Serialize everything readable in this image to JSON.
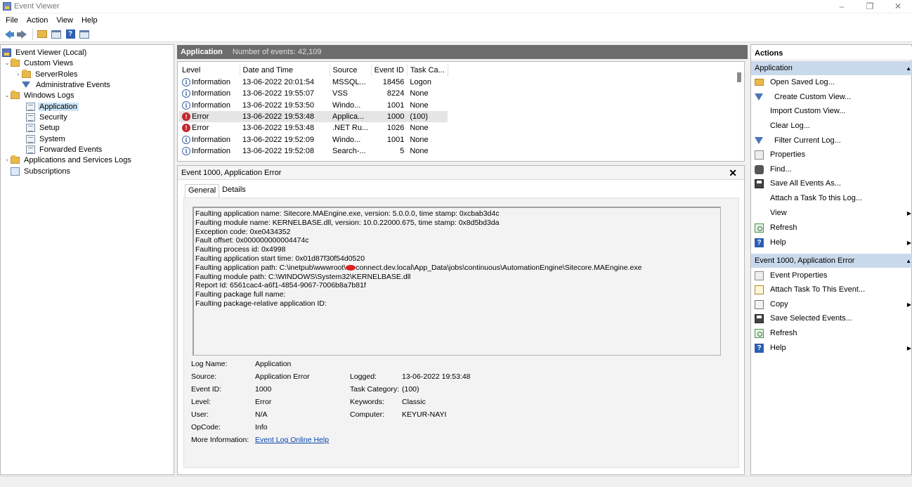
{
  "window": {
    "title": "Event Viewer"
  },
  "menu": [
    "File",
    "Action",
    "View",
    "Help"
  ],
  "tree": [
    {
      "label": "Event Viewer (Local)",
      "icon": "event-viewer-icon"
    },
    {
      "label": "Custom Views",
      "icon": "folder-icon"
    },
    {
      "label": "ServerRoles",
      "icon": "folder-icon"
    },
    {
      "label": "Administrative Events",
      "icon": "filter-icon"
    },
    {
      "label": "Windows Logs",
      "icon": "folder-icon"
    },
    {
      "label": "Application",
      "icon": "log-icon"
    },
    {
      "label": "Security",
      "icon": "log-icon"
    },
    {
      "label": "Setup",
      "icon": "log-icon"
    },
    {
      "label": "System",
      "icon": "log-icon"
    },
    {
      "label": "Forwarded Events",
      "icon": "log-icon"
    },
    {
      "label": "Applications and Services Logs",
      "icon": "folder-icon"
    },
    {
      "label": "Subscriptions",
      "icon": "subscriptions-icon"
    }
  ],
  "events_header": {
    "log": "Application",
    "count": "Number of events: 42,109"
  },
  "events_table": {
    "columns": [
      "Level",
      "Date and Time",
      "Source",
      "Event ID",
      "Task Ca..."
    ],
    "rows": [
      {
        "level": "Information",
        "date": "13-06-2022 20:01:54",
        "source": "MSSQL...",
        "id": "18456",
        "task": "Logon"
      },
      {
        "level": "Information",
        "date": "13-06-2022 19:55:07",
        "source": "VSS",
        "id": "8224",
        "task": "None"
      },
      {
        "level": "Information",
        "date": "13-06-2022 19:53:50",
        "source": "Windo...",
        "id": "1001",
        "task": "None"
      },
      {
        "level": "Error",
        "date": "13-06-2022 19:53:48",
        "source": "Applica...",
        "id": "1000",
        "task": "(100)"
      },
      {
        "level": "Error",
        "date": "13-06-2022 19:53:48",
        "source": ".NET Ru...",
        "id": "1026",
        "task": "None"
      },
      {
        "level": "Information",
        "date": "13-06-2022 19:52:09",
        "source": "Windo...",
        "id": "1001",
        "task": "None"
      },
      {
        "level": "Information",
        "date": "13-06-2022 19:52:08",
        "source": "Search-...",
        "id": "5",
        "task": "None"
      }
    ]
  },
  "detail": {
    "title": "Event 1000, Application Error",
    "tabs": [
      "General",
      "Details"
    ],
    "message_lines": [
      "Faulting application name: Sitecore.MAEngine.exe, version: 5.0.0.0, time stamp: 0xcbab3d4c",
      "Faulting module name: KERNELBASE.dll, version: 10.0.22000.675, time stamp: 0x8d5bd3da",
      "Exception code: 0xe0434352",
      "Fault offset: 0x000000000004474c",
      "Faulting process id: 0x4998",
      "Faulting application start time: 0x01d87f30f54d0520"
    ],
    "path_prefix": "Faulting application path: C:\\inetpub\\wwwroot\\",
    "path_suffix": "connect.dev.local\\App_Data\\jobs\\continuous\\AutomationEngine\\Sitecore.MAEngine.exe",
    "message_lines2": [
      "Faulting module path: C:\\WINDOWS\\System32\\KERNELBASE.dll",
      "Report Id: 6561cac4-a6f1-4854-9067-7006b8a7b81f",
      "Faulting package full name:",
      "Faulting package-relative application ID:"
    ],
    "props": {
      "log_name_k": "Log Name:",
      "log_name_v": "Application",
      "source_k": "Source:",
      "source_v": "Application Error",
      "logged_k": "Logged:",
      "logged_v": "13-06-2022 19:53:48",
      "event_id_k": "Event ID:",
      "event_id_v": "1000",
      "task_k": "Task Category:",
      "task_v": "(100)",
      "level_k": "Level:",
      "level_v": "Error",
      "keywords_k": "Keywords:",
      "keywords_v": "Classic",
      "user_k": "User:",
      "user_v": "N/A",
      "computer_k": "Computer:",
      "computer_v": "KEYUR-NAYI",
      "opcode_k": "OpCode:",
      "opcode_v": "Info",
      "more_k": "More Information:",
      "more_v": "Event Log Online Help"
    }
  },
  "actions": {
    "title": "Actions",
    "section1": "Application",
    "items1": [
      {
        "label": "Open Saved Log...",
        "icon": "open-log-icon"
      },
      {
        "label": "Create Custom View...",
        "icon": "filter-icon"
      },
      {
        "label": "Import Custom View...",
        "icon": ""
      },
      {
        "label": "Clear Log...",
        "icon": ""
      },
      {
        "label": "Filter Current Log...",
        "icon": "filter-icon"
      },
      {
        "label": "Properties",
        "icon": "properties-icon"
      },
      {
        "label": "Find...",
        "icon": "find-icon"
      },
      {
        "label": "Save All Events As...",
        "icon": "save-icon"
      },
      {
        "label": "Attach a Task To this Log...",
        "icon": ""
      },
      {
        "label": "View",
        "icon": ""
      },
      {
        "label": "Refresh",
        "icon": "refresh-icon"
      },
      {
        "label": "Help",
        "icon": "help-icon"
      }
    ],
    "section2": "Event 1000, Application Error",
    "items2": [
      {
        "label": "Event Properties",
        "icon": "properties-icon"
      },
      {
        "label": "Attach Task To This Event...",
        "icon": "task-icon"
      },
      {
        "label": "Copy",
        "icon": "copy-icon"
      },
      {
        "label": "Save Selected Events...",
        "icon": "save-icon"
      },
      {
        "label": "Refresh",
        "icon": "refresh-icon"
      },
      {
        "label": "Help",
        "icon": "help-icon"
      }
    ]
  }
}
